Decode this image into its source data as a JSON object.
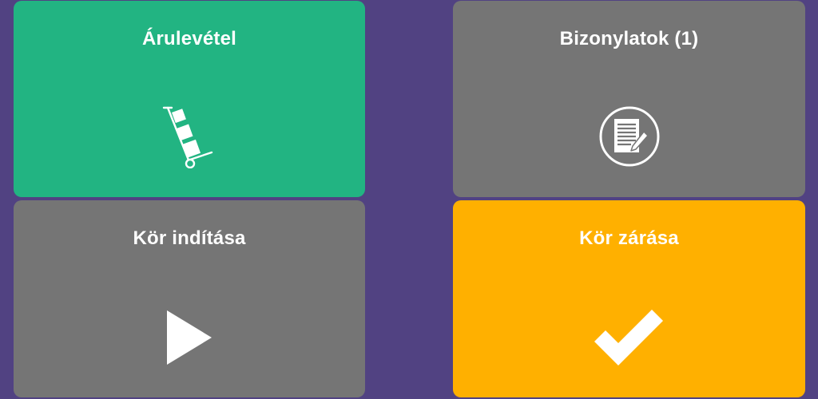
{
  "tiles": {
    "goods_receipt": {
      "label": "Árulevétel",
      "color": "#22b482",
      "icon": "hand-truck-icon"
    },
    "documents": {
      "label": "Bizonylatok (1)",
      "color": "#757575",
      "icon": "document-edit-icon"
    },
    "start_round": {
      "label": "Kör indítása",
      "color": "#757575",
      "icon": "play-icon"
    },
    "close_round": {
      "label": "Kör zárása",
      "color": "#ffb000",
      "icon": "checkmark-icon"
    }
  },
  "colors": {
    "background": "#514282",
    "text": "#ffffff"
  }
}
